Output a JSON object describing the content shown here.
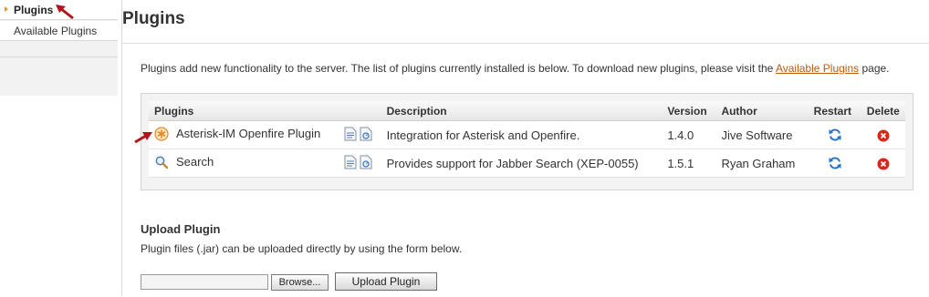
{
  "sidebar": {
    "items": [
      {
        "label": "Plugins",
        "active": true
      },
      {
        "label": "Available Plugins",
        "active": false
      }
    ]
  },
  "page_title": "Plugins",
  "intro": {
    "text_before": "Plugins add new functionality to the server. The list of plugins currently installed is below. To download new plugins, please visit the ",
    "link_text": "Available Plugins",
    "text_after": " page."
  },
  "table": {
    "headers": {
      "plugins": "Plugins",
      "description": "Description",
      "version": "Version",
      "author": "Author",
      "restart": "Restart",
      "delete": "Delete"
    },
    "rows": [
      {
        "name": "Asterisk-IM Openfire Plugin",
        "icon": "asterisk-plugin-icon",
        "description": "Integration for Asterisk and Openfire.",
        "version": "1.4.0",
        "author": "Jive Software"
      },
      {
        "name": "Search",
        "icon": "magnifier-icon",
        "description": "Provides support for Jabber Search (XEP-0055)",
        "version": "1.5.1",
        "author": "Ryan Graham"
      }
    ]
  },
  "upload": {
    "title": "Upload Plugin",
    "description": "Plugin files (.jar) can be uploaded directly by using the form below.",
    "browse_label": "Browse...",
    "button_label": "Upload Plugin"
  },
  "colors": {
    "link": "#c05a0c",
    "annotation_arrow": "#b0161a",
    "sidebar_bullet": "#e09c17",
    "delete_icon": "#d9261c",
    "restart_icon": "#2a74c9"
  }
}
